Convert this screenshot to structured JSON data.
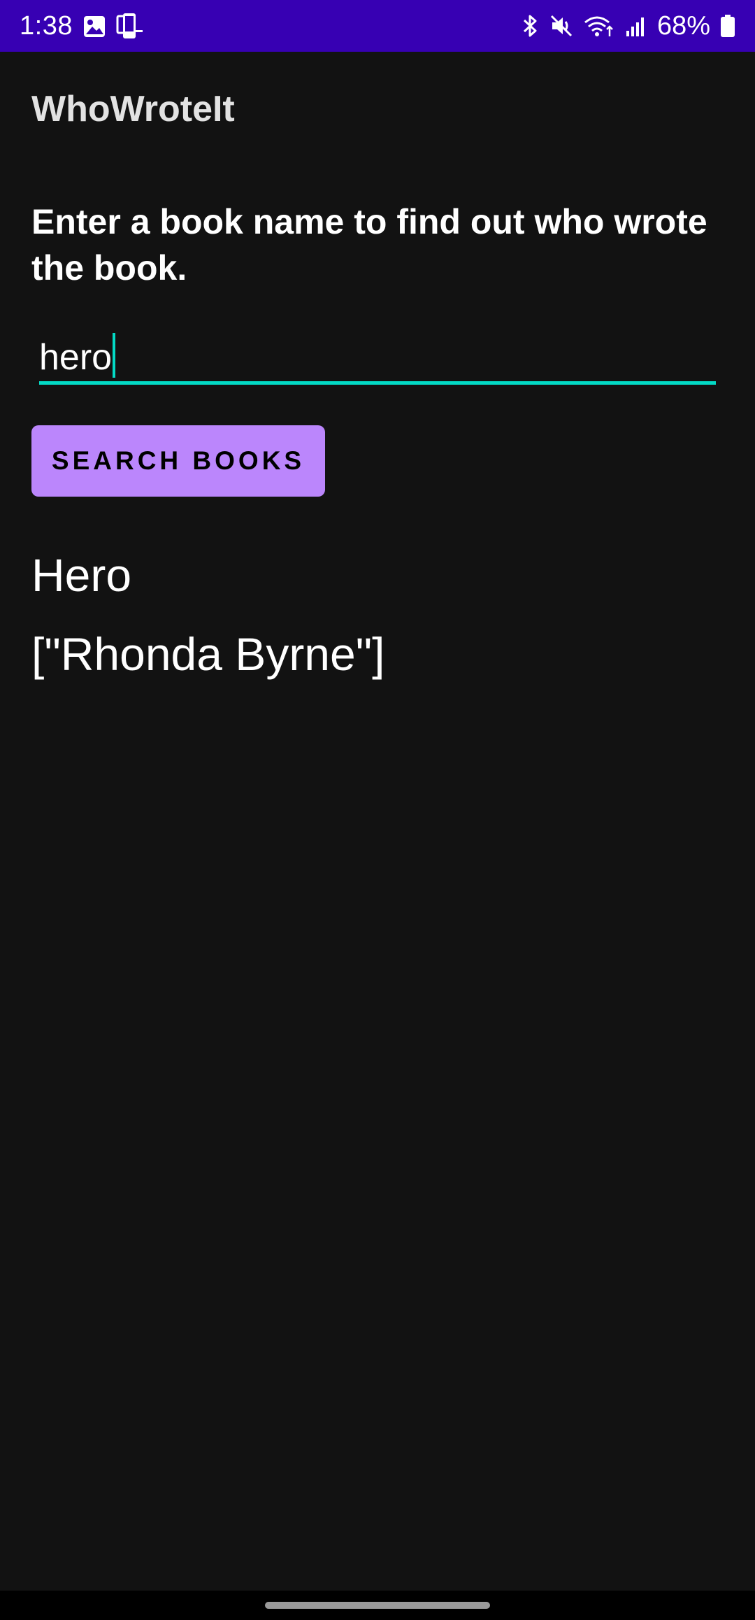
{
  "status_bar": {
    "time": "1:38",
    "battery": "68%",
    "left_icons": [
      "gallery-icon",
      "screen-cast-icon"
    ],
    "right_icons": [
      "bluetooth-icon",
      "mute-icon",
      "wifi-icon",
      "signal-icon",
      "battery-icon"
    ],
    "battery_level": 0.68
  },
  "app_bar": {
    "title": "WhoWroteIt"
  },
  "main": {
    "instructions": "Enter a book name to find out who wrote the book.",
    "search_input": {
      "value": "hero"
    },
    "search_button_label": "Search Books",
    "result_title": "Hero",
    "result_author": "[\"Rhonda Byrne\"]"
  },
  "colors": {
    "status_bar": "#3700b3",
    "background": "#121212",
    "accent": "#03dac5",
    "button": "#bb86fc"
  }
}
